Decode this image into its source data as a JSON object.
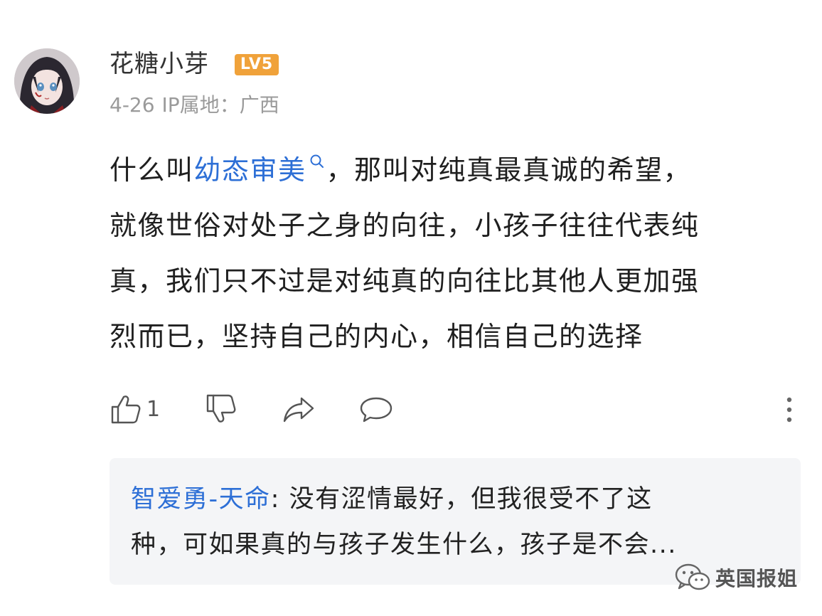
{
  "comment": {
    "username": "花糖小芽",
    "level_badge": "LV5",
    "date": "4-26",
    "ip_location": "IP属地：广西",
    "body_prefix": "什么叫",
    "body_link": "幼态审美",
    "lines": [
      "，那叫对纯真最真诚的希望，",
      "就像世俗对处子之身的向往，小孩子往往代表纯",
      "真，我们只不过是对纯真的向往比其他人更加强",
      "烈而已，坚持自己的内心，相信自己的选择"
    ]
  },
  "actions": {
    "like_count": "1",
    "like_icon": "thumbs-up-icon",
    "dislike_icon": "thumbs-down-icon",
    "share_icon": "share-arrow-icon",
    "reply_icon": "comment-bubble-icon",
    "more_icon": "more-vertical-icon"
  },
  "reply": {
    "author": "智爱勇-天命",
    "separator": ":",
    "text_line1": "没有涩情最好，但我很受不了这",
    "text_line2": "种，可如果真的与孩子发生什么，孩子是不会..."
  },
  "watermark": {
    "text": "英国报姐",
    "icon": "wechat-icon"
  },
  "colors": {
    "link": "#2d6fd6",
    "badge": "#f0a23a",
    "meta": "#9a9a9a",
    "reply_bg": "#f4f5f7"
  }
}
